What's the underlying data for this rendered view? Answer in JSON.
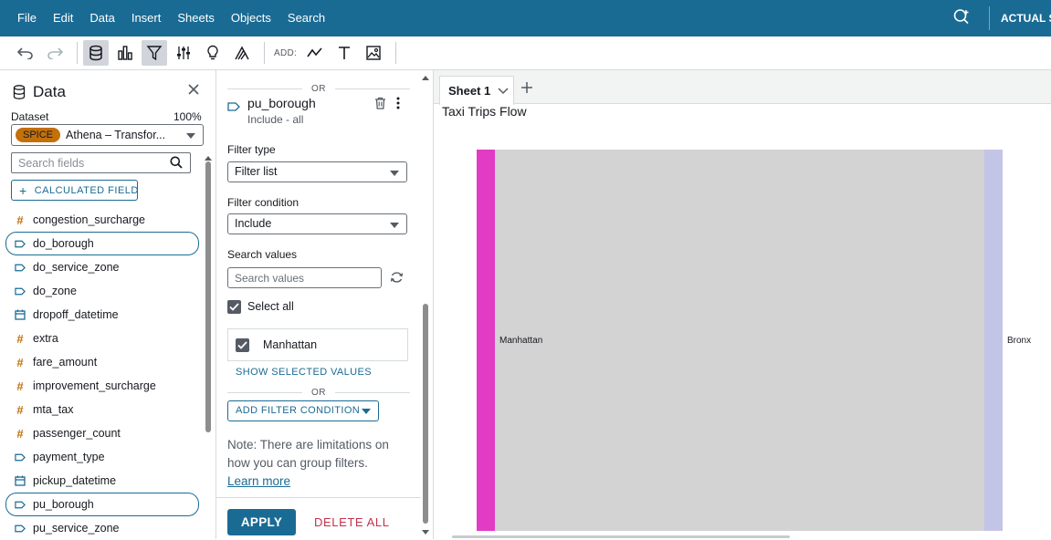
{
  "menu": {
    "items": [
      "File",
      "Edit",
      "Data",
      "Insert",
      "Sheets",
      "Objects",
      "Search"
    ],
    "account_label": "ACTUAL SE"
  },
  "toolbar": {
    "add_label": "ADD:"
  },
  "data_panel": {
    "title": "Data",
    "dataset_label": "Dataset",
    "spice_percent": "100%",
    "spice_badge": "SPICE",
    "dataset_name": "Athena – Transfor...",
    "search_placeholder": "Search fields",
    "calculated_field_label": "CALCULATED FIELD",
    "fields": [
      {
        "name": "congestion_surcharge",
        "type": "measure",
        "selected": false
      },
      {
        "name": "do_borough",
        "type": "dimension",
        "selected": true
      },
      {
        "name": "do_service_zone",
        "type": "dimension",
        "selected": false
      },
      {
        "name": "do_zone",
        "type": "dimension",
        "selected": false
      },
      {
        "name": "dropoff_datetime",
        "type": "date",
        "selected": false
      },
      {
        "name": "extra",
        "type": "measure",
        "selected": false
      },
      {
        "name": "fare_amount",
        "type": "measure",
        "selected": false
      },
      {
        "name": "improvement_surcharge",
        "type": "measure",
        "selected": false
      },
      {
        "name": "mta_tax",
        "type": "measure",
        "selected": false
      },
      {
        "name": "passenger_count",
        "type": "measure",
        "selected": false
      },
      {
        "name": "payment_type",
        "type": "dimension",
        "selected": false
      },
      {
        "name": "pickup_datetime",
        "type": "date",
        "selected": false
      },
      {
        "name": "pu_borough",
        "type": "dimension",
        "selected": true
      },
      {
        "name": "pu_service_zone",
        "type": "dimension",
        "selected": false
      }
    ]
  },
  "filter_panel": {
    "or_top": "OR",
    "field_name": "pu_borough",
    "field_summary": "Include - all",
    "filter_type_label": "Filter type",
    "filter_type_value": "Filter list",
    "filter_condition_label": "Filter condition",
    "filter_condition_value": "Include",
    "search_values_label": "Search values",
    "search_values_placeholder": "Search values",
    "select_all_label": "Select all",
    "value_item": "Manhattan",
    "show_selected_label": "SHOW SELECTED VALUES",
    "or_bottom": "OR",
    "add_filter_condition_label": "ADD FILTER CONDITION",
    "note_text": "Note: There are limitations on how you can group filters.",
    "learn_more": "Learn more",
    "apply_label": "APPLY",
    "delete_all_label": "DELETE ALL"
  },
  "sheet": {
    "tab_label": "Sheet 1",
    "visual_title": "Taxi Trips Flow"
  },
  "chart_data": {
    "type": "sankey",
    "nodes": [
      {
        "name": "Manhattan",
        "side": "source",
        "color": "#e23bc4"
      },
      {
        "name": "Bronx",
        "side": "target",
        "color": "#c3c5e6"
      }
    ],
    "links": [
      {
        "source": "Manhattan",
        "target": "Bronx",
        "color": "#d3d3d3"
      }
    ]
  }
}
